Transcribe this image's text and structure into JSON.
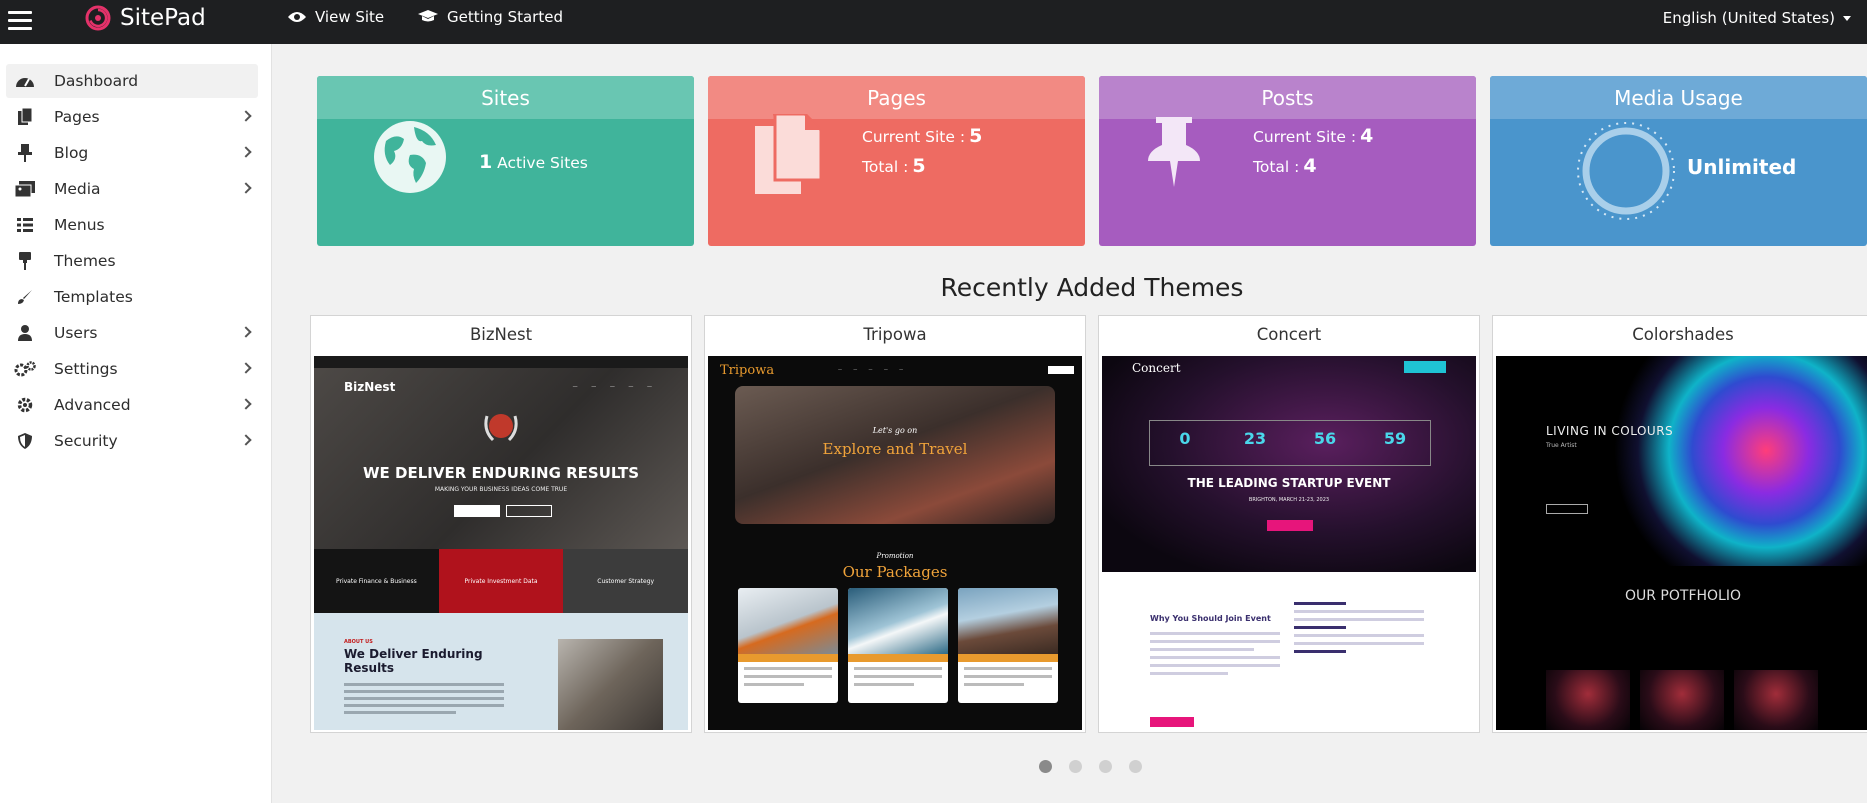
{
  "topbar": {
    "brand": "SitePad",
    "view_site": "View Site",
    "getting_started": "Getting Started",
    "language": "English (United States)"
  },
  "sidebar": {
    "items": [
      {
        "label": "Dashboard",
        "icon": "dashboard-icon",
        "has_submenu": false,
        "active": true
      },
      {
        "label": "Pages",
        "icon": "pages-icon",
        "has_submenu": true
      },
      {
        "label": "Blog",
        "icon": "pin-icon",
        "has_submenu": true
      },
      {
        "label": "Media",
        "icon": "media-icon",
        "has_submenu": true
      },
      {
        "label": "Menus",
        "icon": "menu-list-icon",
        "has_submenu": false
      },
      {
        "label": "Themes",
        "icon": "paint-roller-icon",
        "has_submenu": false
      },
      {
        "label": "Templates",
        "icon": "brush-icon",
        "has_submenu": false
      },
      {
        "label": "Users",
        "icon": "user-icon",
        "has_submenu": true
      },
      {
        "label": "Settings",
        "icon": "cogs-icon",
        "has_submenu": true
      },
      {
        "label": "Advanced",
        "icon": "gear-icon",
        "has_submenu": true
      },
      {
        "label": "Security",
        "icon": "shield-icon",
        "has_submenu": true
      }
    ]
  },
  "stats": {
    "sites": {
      "title": "Sites",
      "count": "1",
      "label": "Active Sites"
    },
    "pages": {
      "title": "Pages",
      "current_label": "Current Site :",
      "current": "5",
      "total_label": "Total :",
      "total": "5"
    },
    "posts": {
      "title": "Posts",
      "current_label": "Current Site :",
      "current": "4",
      "total_label": "Total :",
      "total": "4"
    },
    "media": {
      "title": "Media Usage",
      "value": "Unlimited"
    }
  },
  "themes_section": {
    "title": "Recently Added Themes",
    "themes": [
      {
        "name": "BizNest",
        "preview": {
          "logo": "BizNest",
          "headline": "WE DELIVER  ENDURING RESULTS",
          "subline": "MAKING YOUR BUSINESS IDEAS COME TRUE",
          "row": [
            "Private Finance & Business",
            "Private Investment Data",
            "Customer Strategy"
          ],
          "about_label": "ABOUT US",
          "about_title": "We Deliver Enduring Results"
        }
      },
      {
        "name": "Tripowa",
        "preview": {
          "logo": "Tripowa",
          "hero_small": "Let's go on",
          "hero_title": "Explore and Travel",
          "promo": "Promotion",
          "packages": "Our Packages"
        }
      },
      {
        "name": "Concert",
        "preview": {
          "logo": "Concert",
          "countdown": [
            "0",
            "23",
            "56",
            "59"
          ],
          "headline": "THE LEADING STARTUP EVENT",
          "date": "BRIGHTON, MARCH 21-23, 2023",
          "section": "Why You Should Join Event"
        }
      },
      {
        "name": "Colorshades",
        "preview": {
          "headline": "LIVING IN COLOURS",
          "sub": "True Artist",
          "portfolio": "OUR POTFHOLIO"
        }
      }
    ]
  },
  "carousel": {
    "pages": 4,
    "active": 0
  },
  "colors": {
    "topbar": "#1e1f21",
    "sites": "#40b49b",
    "pages": "#ee6b62",
    "posts": "#a65cbf",
    "media": "#4a95cc"
  }
}
